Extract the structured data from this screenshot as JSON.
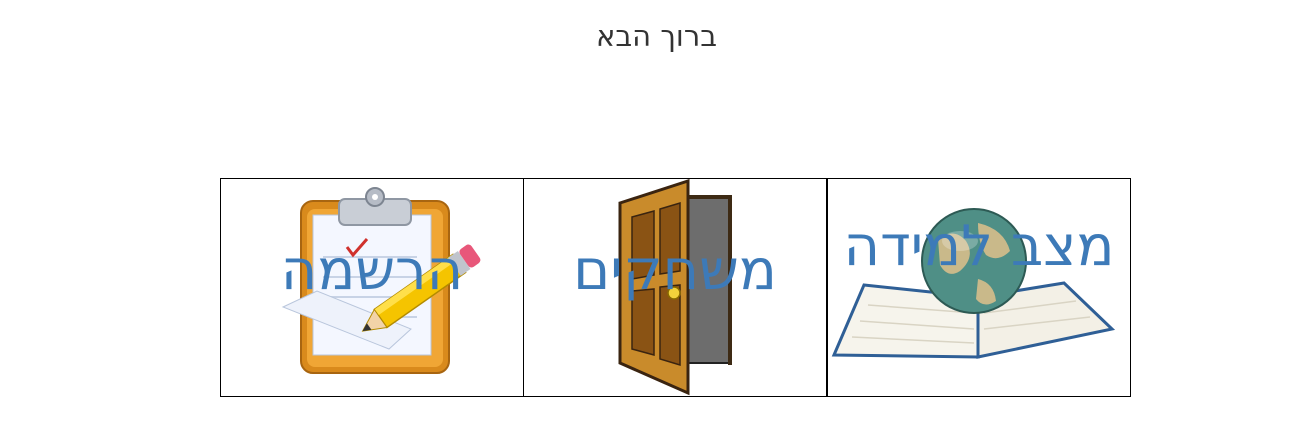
{
  "page": {
    "title": "ברוך הבא"
  },
  "tiles": [
    {
      "label": "הרשמה",
      "icon": "clipboard-pencil-icon"
    },
    {
      "label": "משחקים",
      "icon": "open-door-icon"
    },
    {
      "label": "מצב למידה",
      "icon": "globe-on-book-icon"
    }
  ],
  "colors": {
    "label": "#3d7ab8",
    "title": "#333333",
    "border": "#000000"
  }
}
